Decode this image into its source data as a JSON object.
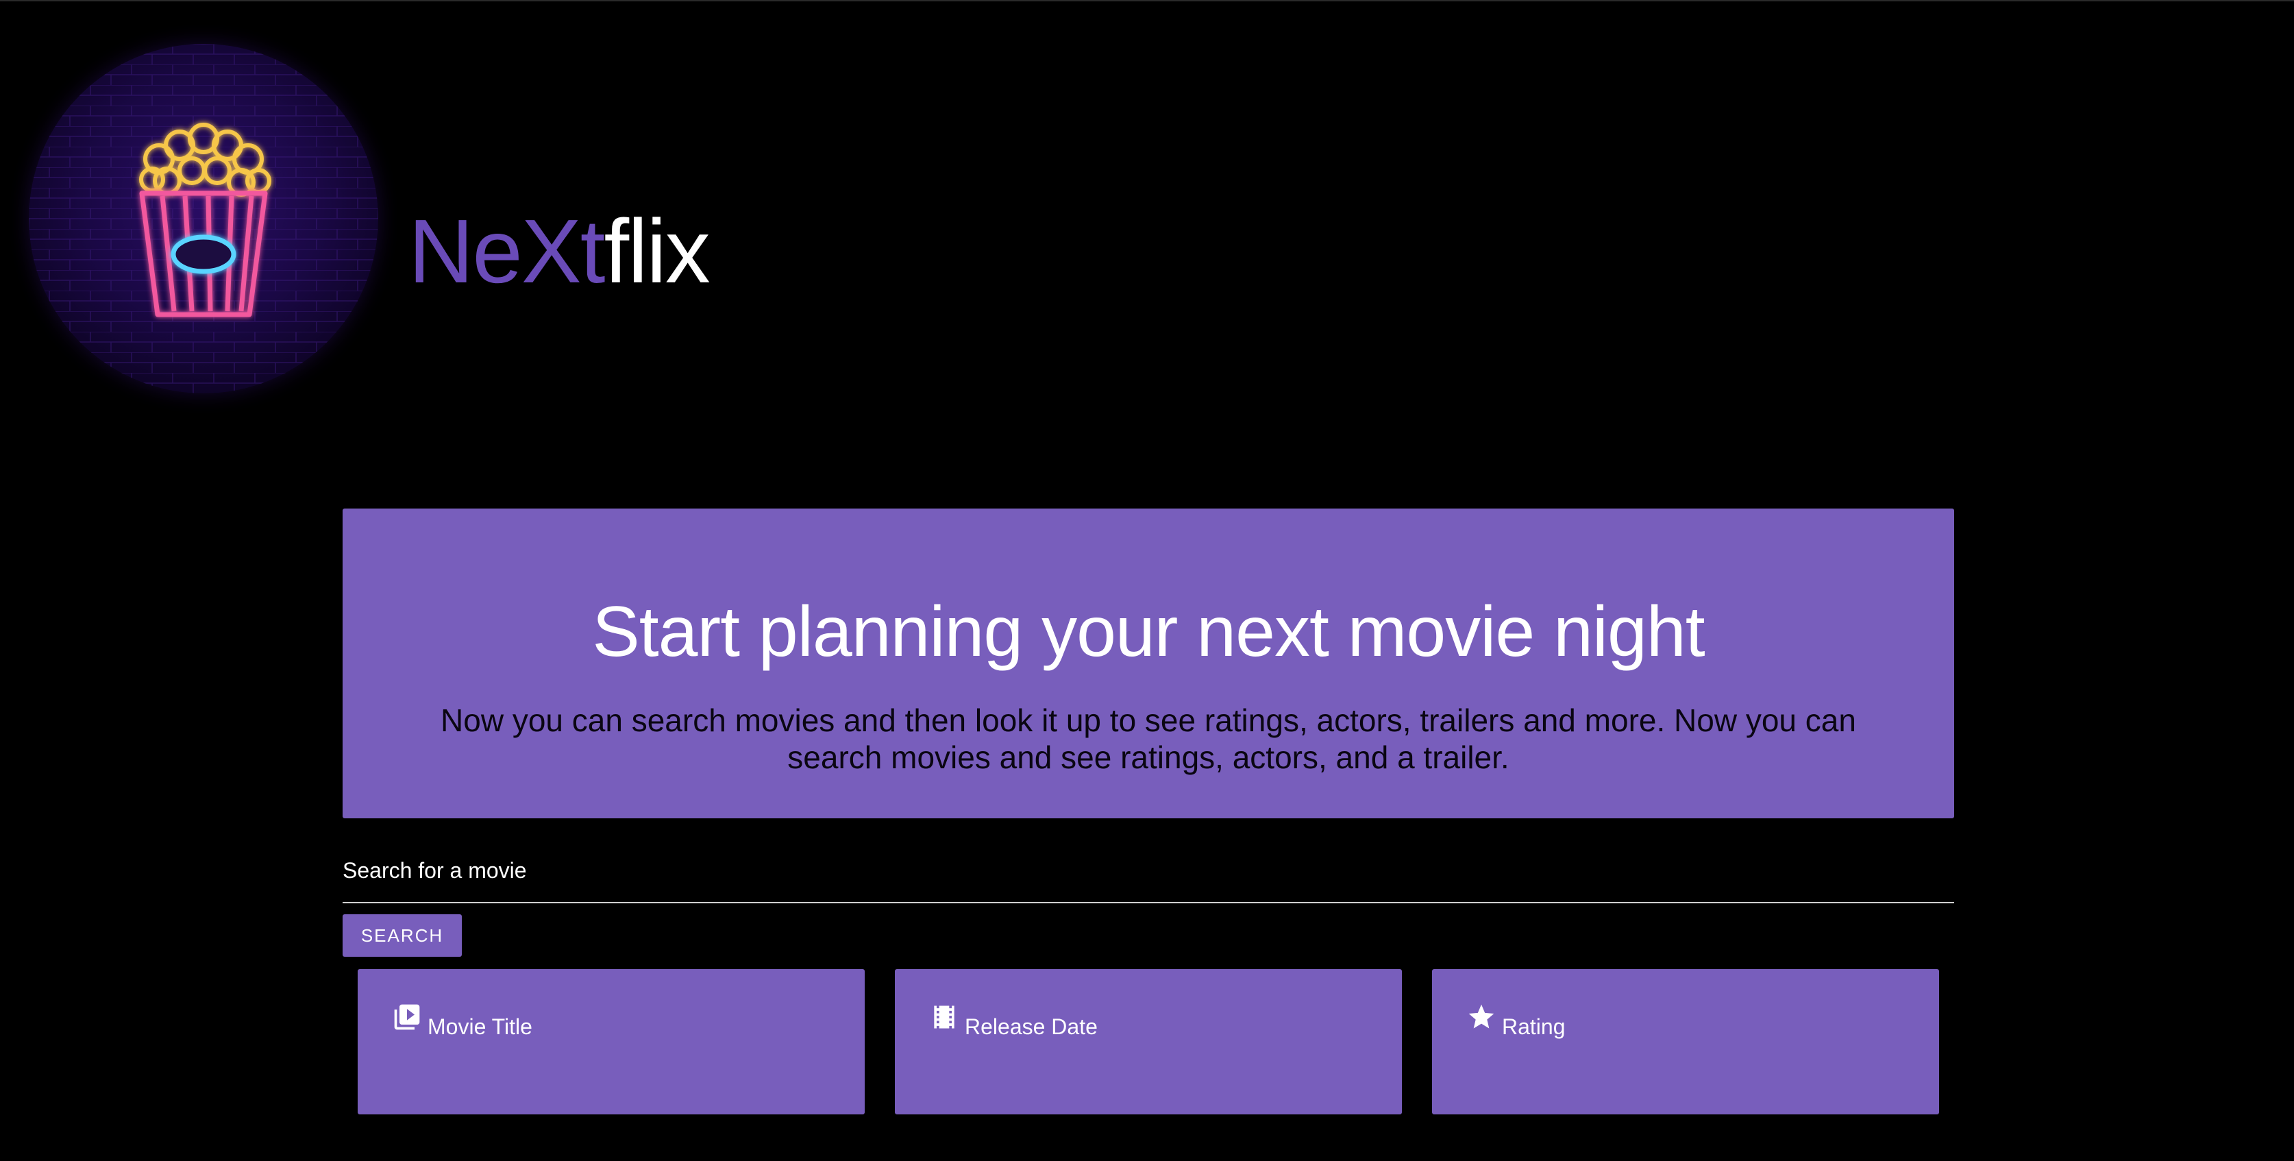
{
  "header": {
    "logo_icon": "popcorn-neon-icon",
    "brand_part1": "NeXt",
    "brand_part2": "flix"
  },
  "hero": {
    "title": "Start planning your next movie night",
    "text": "Now you can search movies and then look it up to see ratings, actors, trailers and more. Now you can search movies and see ratings, actors, and a trailer."
  },
  "search": {
    "label": "Search for a movie",
    "value": "",
    "button_label": "SEARCH"
  },
  "cards": [
    {
      "icon": "video-library-icon",
      "label": "Movie Title"
    },
    {
      "icon": "film-strip-icon",
      "label": "Release Date"
    },
    {
      "icon": "star-icon",
      "label": "Rating"
    }
  ],
  "colors": {
    "background": "#000000",
    "accent": "#785ebc",
    "brand_purple": "#6a4bb8",
    "text_light": "#ffffff",
    "text_dark": "#0a0612"
  }
}
